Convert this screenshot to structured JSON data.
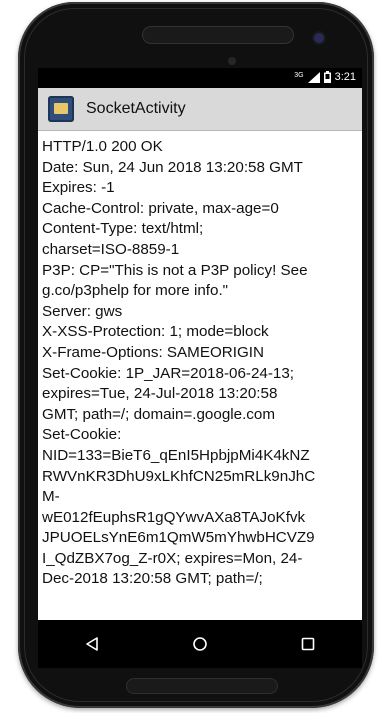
{
  "statusbar": {
    "network_type": "3G",
    "time": "3:21",
    "icons": [
      "signal-icon",
      "battery-icon"
    ]
  },
  "app": {
    "title": "SocketActivity",
    "icon": "app-icon"
  },
  "response_lines": [
    "HTTP/1.0 200 OK",
    "Date: Sun, 24 Jun 2018 13:20:58 GMT",
    "Expires: -1",
    "Cache-Control: private, max-age=0",
    "Content-Type: text/html;",
    "charset=ISO-8859-1",
    "P3P: CP=\"This is not a P3P policy! See",
    "g.co/p3phelp for more info.\"",
    "Server: gws",
    "X-XSS-Protection: 1; mode=block",
    "X-Frame-Options: SAMEORIGIN",
    "Set-Cookie: 1P_JAR=2018-06-24-13;",
    "expires=Tue, 24-Jul-2018 13:20:58",
    "GMT; path=/; domain=.google.com",
    "Set-Cookie:",
    "NID=133=BieT6_qEnI5HpbjpMi4K4kNZ",
    "RWVnKR3DhU9xLKhfCN25mRLk9nJhC",
    "M-",
    "wE012fEuphsR1gQYwvAXa8TAJoKfvk",
    "JPUOELsYnE6m1QmW5mYhwbHCVZ9",
    "I_QdZBX7og_Z-r0X; expires=Mon, 24-",
    "Dec-2018 13:20:58 GMT; path=/;"
  ],
  "navbar": {
    "back": "back-icon",
    "home": "home-icon",
    "recents": "recents-icon"
  }
}
